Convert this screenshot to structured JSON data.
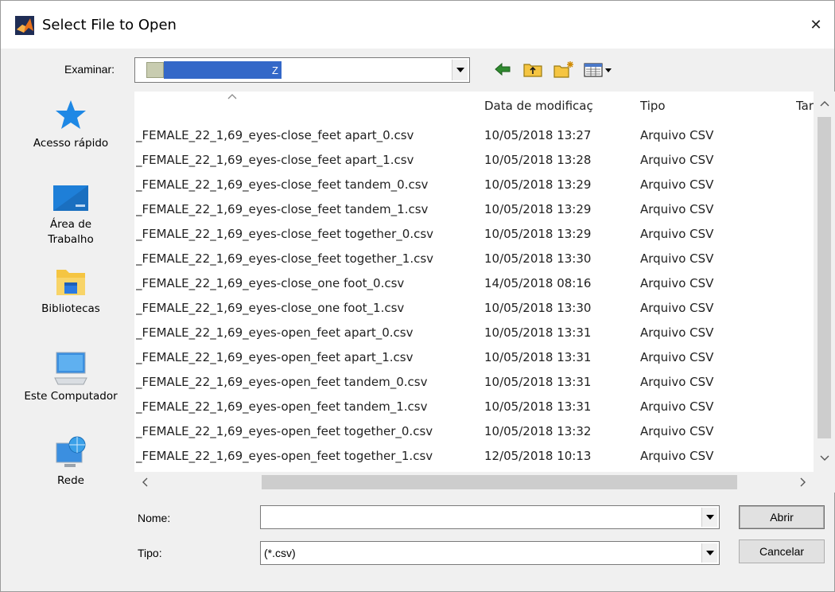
{
  "window": {
    "title": "Select File to Open",
    "app_icon": "matlab-icon",
    "close_glyph": "✕"
  },
  "toolbar": {
    "look_in_label": "Examinar:",
    "look_in_value": "Z",
    "icons": [
      "back-arrow-icon",
      "up-folder-icon",
      "new-folder-icon",
      "view-menu-icon"
    ]
  },
  "places": [
    {
      "label": "Acesso rápido",
      "icon": "star-icon"
    },
    {
      "label": "Área de Trabalho",
      "icon": "desktop-icon"
    },
    {
      "label": "Bibliotecas",
      "icon": "libraries-icon"
    },
    {
      "label": "Este Computador",
      "icon": "computer-icon"
    },
    {
      "label": "Rede",
      "icon": "network-icon"
    }
  ],
  "columns": {
    "name": "",
    "date": "Data de modificaç",
    "type": "Tipo",
    "size": "Tar"
  },
  "files": [
    {
      "name": "_FEMALE_22_1,69_eyes-close_feet apart_0.csv",
      "date": "10/05/2018 13:27",
      "type": "Arquivo CSV"
    },
    {
      "name": "_FEMALE_22_1,69_eyes-close_feet apart_1.csv",
      "date": "10/05/2018 13:28",
      "type": "Arquivo CSV"
    },
    {
      "name": "_FEMALE_22_1,69_eyes-close_feet tandem_0.csv",
      "date": "10/05/2018 13:29",
      "type": "Arquivo CSV"
    },
    {
      "name": "_FEMALE_22_1,69_eyes-close_feet tandem_1.csv",
      "date": "10/05/2018 13:29",
      "type": "Arquivo CSV"
    },
    {
      "name": "_FEMALE_22_1,69_eyes-close_feet together_0.csv",
      "date": "10/05/2018 13:29",
      "type": "Arquivo CSV"
    },
    {
      "name": "_FEMALE_22_1,69_eyes-close_feet together_1.csv",
      "date": "10/05/2018 13:30",
      "type": "Arquivo CSV"
    },
    {
      "name": "_FEMALE_22_1,69_eyes-close_one foot_0.csv",
      "date": "14/05/2018 08:16",
      "type": "Arquivo CSV"
    },
    {
      "name": "_FEMALE_22_1,69_eyes-close_one foot_1.csv",
      "date": "10/05/2018 13:30",
      "type": "Arquivo CSV"
    },
    {
      "name": "_FEMALE_22_1,69_eyes-open_feet apart_0.csv",
      "date": "10/05/2018 13:31",
      "type": "Arquivo CSV"
    },
    {
      "name": "_FEMALE_22_1,69_eyes-open_feet apart_1.csv",
      "date": "10/05/2018 13:31",
      "type": "Arquivo CSV"
    },
    {
      "name": "_FEMALE_22_1,69_eyes-open_feet tandem_0.csv",
      "date": "10/05/2018 13:31",
      "type": "Arquivo CSV"
    },
    {
      "name": "_FEMALE_22_1,69_eyes-open_feet tandem_1.csv",
      "date": "10/05/2018 13:31",
      "type": "Arquivo CSV"
    },
    {
      "name": "_FEMALE_22_1,69_eyes-open_feet together_0.csv",
      "date": "10/05/2018 13:32",
      "type": "Arquivo CSV"
    },
    {
      "name": "_FEMALE_22_1,69_eyes-open_feet together_1.csv",
      "date": "12/05/2018 10:13",
      "type": "Arquivo CSV"
    }
  ],
  "form": {
    "name_label": "Nome:",
    "name_value": "",
    "type_label": "Tipo:",
    "type_value": "(*.csv)"
  },
  "buttons": {
    "open": "Abrir",
    "cancel": "Cancelar"
  },
  "colors": {
    "selection": "#3468c8",
    "window_bg": "#f0f0f0",
    "accent_star": "#1e88e5"
  }
}
